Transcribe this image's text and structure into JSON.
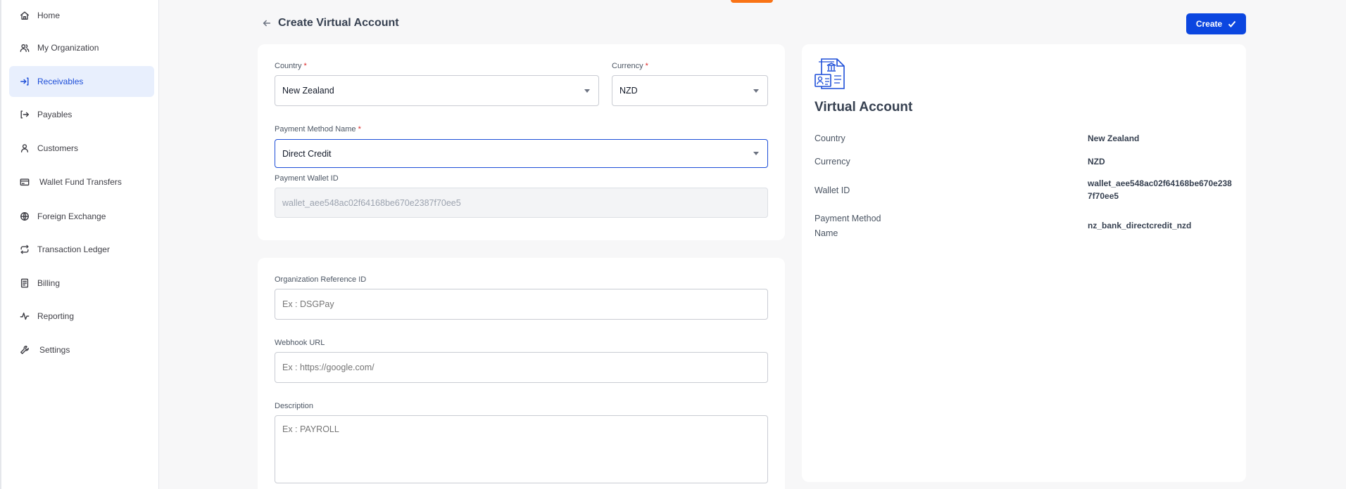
{
  "sidebar": {
    "items": [
      {
        "label": "Home",
        "icon": "home-icon"
      },
      {
        "label": "My Organization",
        "icon": "users-icon"
      },
      {
        "label": "Receivables",
        "icon": "receive-icon",
        "active": true
      },
      {
        "label": "Payables",
        "icon": "pay-icon"
      },
      {
        "label": "Customers",
        "icon": "user-icon"
      },
      {
        "label": "Wallet Fund Transfers",
        "icon": "wallet-icon"
      },
      {
        "label": "Foreign Exchange",
        "icon": "globe-icon"
      },
      {
        "label": "Transaction Ledger",
        "icon": "repeat-icon"
      },
      {
        "label": "Billing",
        "icon": "receipt-icon"
      },
      {
        "label": "Reporting",
        "icon": "activity-icon"
      },
      {
        "label": "Settings",
        "icon": "wrench-icon"
      }
    ]
  },
  "header": {
    "title": "Create Virtual Account",
    "create_label": "Create"
  },
  "form": {
    "country": {
      "label": "Country",
      "required": "*",
      "value": "New Zealand"
    },
    "currency": {
      "label": "Currency",
      "required": "*",
      "value": "NZD"
    },
    "payment_method": {
      "label": "Payment Method Name",
      "required": "*",
      "value": "Direct Credit"
    },
    "wallet_id": {
      "label": "Payment Wallet ID",
      "value": "wallet_aee548ac02f64168be670e2387f70ee5"
    },
    "org_ref": {
      "label": "Organization Reference ID",
      "placeholder": "Ex : DSGPay"
    },
    "webhook": {
      "label": "Webhook URL",
      "placeholder": "Ex : https://google.com/"
    },
    "description": {
      "label": "Description",
      "placeholder": "Ex : PAYROLL"
    }
  },
  "summary": {
    "title": "Virtual Account",
    "country_key": "Country",
    "country_val": "New Zealand",
    "currency_key": "Currency",
    "currency_val": "NZD",
    "wallet_key": "Wallet ID",
    "wallet_val": "wallet_aee548ac02f64168be670e2387f70ee5",
    "method_key_1": "Payment Method",
    "method_key_2": "Name",
    "method_val": "nz_bank_directcredit_nzd"
  },
  "colors": {
    "primary": "#0b46e0",
    "accent": "#f97316",
    "active_bg": "#e8effd",
    "required": "#dc2626"
  }
}
